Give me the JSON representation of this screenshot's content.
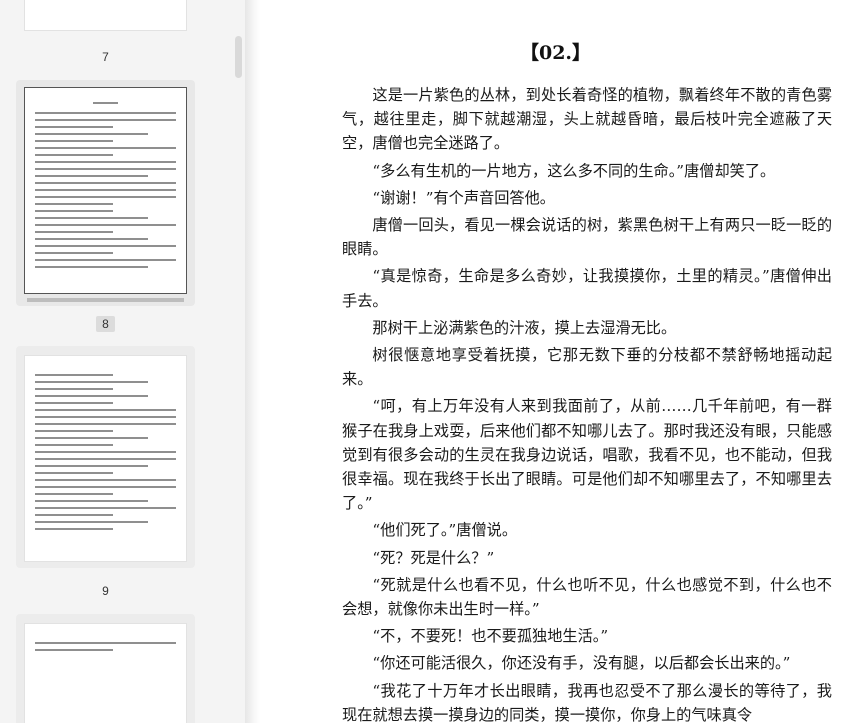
{
  "sidebar": {
    "page_labels": [
      "7",
      "8",
      "9"
    ],
    "active_page": "8"
  },
  "document": {
    "chapter_title": "【02.】",
    "paragraphs": [
      "这是一片紫色的丛林，到处长着奇怪的植物，飘着终年不散的青色雾气，越往里走，脚下就越潮湿，头上就越昏暗，最后枝叶完全遮蔽了天空，唐僧也完全迷路了。",
      "“多么有生机的一片地方，这么多不同的生命。”唐僧却笑了。",
      "“谢谢！”有个声音回答他。",
      "唐僧一回头，看见一棵会说话的树，紫黑色树干上有两只一眨一眨的眼睛。",
      "“真是惊奇，生命是多么奇妙，让我摸摸你，土里的精灵。”唐僧伸出手去。",
      "那树干上泌满紫色的汁液，摸上去湿滑无比。",
      "树很惬意地享受着抚摸，它那无数下垂的分枝都不禁舒畅地摇动起来。",
      "“呵，有上万年没有人来到我面前了，从前……几千年前吧，有一群猴子在我身上戏耍，后来他们都不知哪儿去了。那时我还没有眼，只能感觉到有很多会动的生灵在我身边说话，唱歌，我看不见，也不能动，但我很幸福。现在我终于长出了眼睛。可是他们却不知哪里去了，不知哪里去了。”",
      "“他们死了。”唐僧说。",
      "“死？死是什么？”",
      "“死就是什么也看不见，什么也听不见，什么也感觉不到，什么也不会想，就像你未出生时一样。”",
      "“不，不要死！也不要孤独地生活。”",
      "“你还可能活很久，你还没有手，没有腿，以后都会长出来的。”",
      "“我花了十万年才长出眼睛，我再也忍受不了那么漫长的等待了，我现在就想去摸一摸身边的同类，摸一摸你，你身上的气味真令"
    ]
  }
}
